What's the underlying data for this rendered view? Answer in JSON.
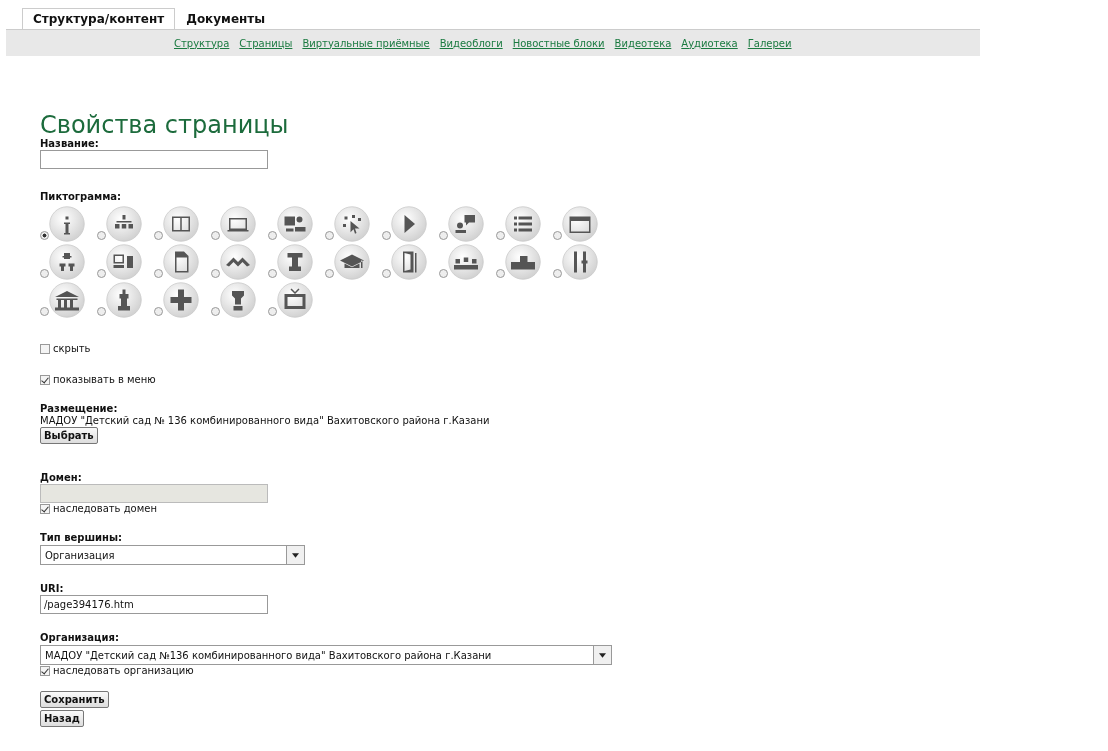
{
  "tabs": [
    {
      "label": "Структура/контент",
      "selected": true
    },
    {
      "label": "Документы",
      "selected": false
    }
  ],
  "nav_links": [
    "Структура",
    "Страницы",
    "Виртуальные приёмные",
    "Видеоблоги",
    "Новостные блоки",
    "Видеотека",
    "Аудиотека",
    "Галереи"
  ],
  "heading": "Свойства страницы",
  "name_field": {
    "label": "Название:"
  },
  "pictogram": {
    "label": "Пиктограмма:",
    "items": [
      {
        "selected": true
      },
      {
        "selected": false
      },
      {
        "selected": false
      },
      {
        "selected": false
      },
      {
        "selected": false
      },
      {
        "selected": false
      },
      {
        "selected": false
      },
      {
        "selected": false
      },
      {
        "selected": false
      },
      {
        "selected": false
      },
      {
        "selected": false
      },
      {
        "selected": false
      },
      {
        "selected": false
      },
      {
        "selected": false
      },
      {
        "selected": false
      },
      {
        "selected": false
      },
      {
        "selected": false
      },
      {
        "selected": false
      },
      {
        "selected": false
      },
      {
        "selected": false
      },
      {
        "selected": false
      },
      {
        "selected": false
      },
      {
        "selected": false
      },
      {
        "selected": false
      },
      {
        "selected": false
      }
    ]
  },
  "hide": {
    "label": "скрыть",
    "checked": false
  },
  "show_in_menu": {
    "label": "показывать в меню",
    "checked": true
  },
  "placement": {
    "label": "Размещение:",
    "value": "МАДОУ \"Детский сад № 136 комбинированного вида\" Вахитовского района г.Казани",
    "button": "Выбрать"
  },
  "domain": {
    "label": "Домен:",
    "disabled": true,
    "inherit": {
      "label": "наследовать домен",
      "checked": true
    }
  },
  "node_type": {
    "label": "Тип вершины:",
    "value": "Организация"
  },
  "uri": {
    "label": "URI:",
    "value": "/page394176.htm"
  },
  "organization": {
    "label": "Организация:",
    "value": "МАДОУ \"Детский сад №136 комбинированного вида\" Вахитовского района г.Казани",
    "inherit": {
      "label": "наследовать организацию",
      "checked": true
    }
  },
  "buttons": [
    "Сохранить",
    "Назад"
  ]
}
